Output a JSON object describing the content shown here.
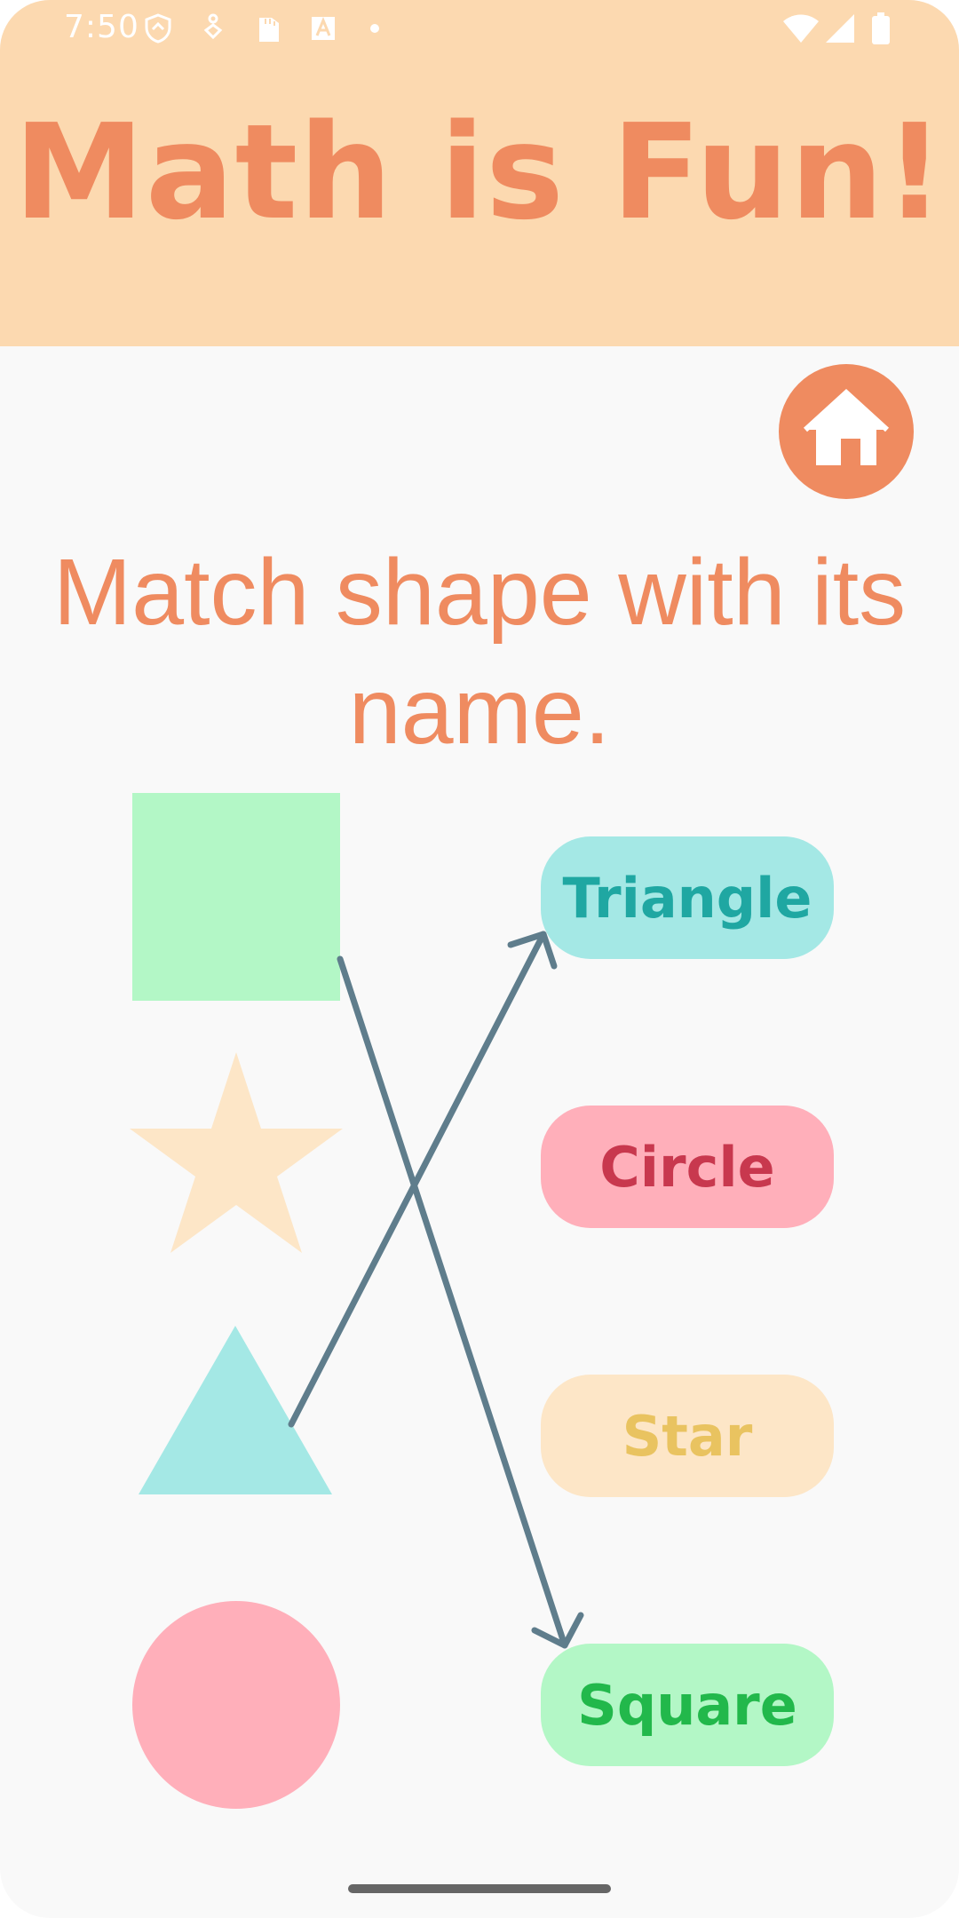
{
  "status_bar": {
    "time": "7:50",
    "left_icons": [
      "shield-icon",
      "accessibility-icon",
      "sd-card-icon",
      "font-icon",
      "dot-icon"
    ],
    "right_icons": [
      "wifi-icon",
      "cellular-signal-icon",
      "battery-icon"
    ]
  },
  "header": {
    "title": "Math is Fun!",
    "background": "#fcd9b0",
    "title_color": "#ef8b60"
  },
  "home_button": {
    "icon": "home-icon",
    "color": "#ef8b60"
  },
  "instruction": {
    "line1": "Match shape with its",
    "line2": "name."
  },
  "shapes": [
    {
      "shape": "square",
      "color": "#b3f7c6"
    },
    {
      "shape": "star",
      "color": "#fde6c7"
    },
    {
      "shape": "triangle",
      "color": "#a4e8e5"
    },
    {
      "shape": "circle",
      "color": "#ffafba"
    }
  ],
  "names": [
    {
      "label": "Triangle",
      "background": "#a4e8e5",
      "text_color": "#1fa7a2"
    },
    {
      "label": "Circle",
      "background": "#ffafba",
      "text_color": "#c8384e"
    },
    {
      "label": "Star",
      "background": "#fde6c7",
      "text_color": "#e9c360"
    },
    {
      "label": "Square",
      "background": "#b3f7c6",
      "text_color": "#22b84b"
    }
  ],
  "connections": [
    {
      "from": "square",
      "to": "Square"
    },
    {
      "from": "triangle",
      "to": "Triangle"
    }
  ],
  "connector_color": "#5f7d8c"
}
